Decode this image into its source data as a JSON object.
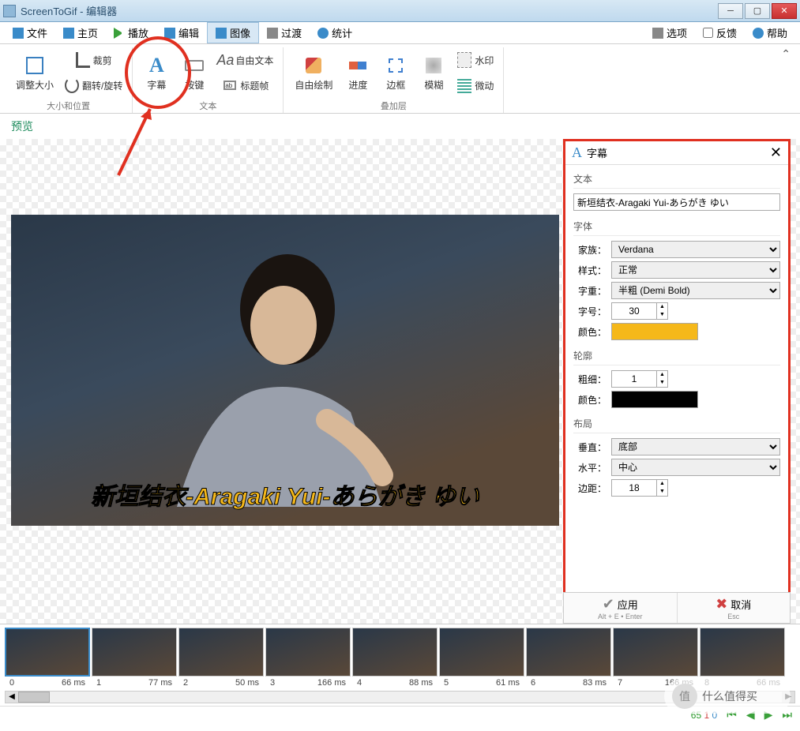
{
  "window": {
    "title": "ScreenToGif - 编辑器"
  },
  "menu": {
    "file": "文件",
    "home": "主页",
    "play": "播放",
    "edit": "编辑",
    "image": "图像",
    "transition": "过渡",
    "stats": "统计",
    "options": "选项",
    "feedback": "反馈",
    "help": "帮助"
  },
  "ribbon": {
    "groups": {
      "size": {
        "label": "大小和位置",
        "resize": "调整大小",
        "crop": "裁剪",
        "rotate": "翻转/旋转"
      },
      "text": {
        "label": "文本",
        "caption": "字幕",
        "keys": "按键",
        "free": "自由文本",
        "title": "标题帧"
      },
      "overlay": {
        "label": "叠加层",
        "draw": "自由绘制",
        "progress": "进度",
        "border": "边框",
        "blur": "模糊",
        "water": "水印",
        "micro": "微动"
      }
    }
  },
  "preview_label": "预览",
  "caption_preview": "新垣结衣-Aragaki Yui-あらがき ゆい",
  "panel": {
    "title": "字幕",
    "text_section": "文本",
    "text_value": "新垣结衣-Aragaki Yui-あらがき ゆい",
    "font_section": "字体",
    "family_lbl": "家族：",
    "family_val": "Verdana",
    "style_lbl": "样式：",
    "style_val": "正常",
    "weight_lbl": "字重：",
    "weight_val": "半粗 (Demi Bold)",
    "size_lbl": "字号：",
    "size_val": "30",
    "color_lbl": "颜色：",
    "color_val": "#f5b81a",
    "outline_section": "轮廓",
    "thick_lbl": "粗细：",
    "thick_val": "1",
    "ocolor_lbl": "颜色：",
    "ocolor_val": "#000000",
    "layout_section": "布局",
    "vert_lbl": "垂直：",
    "vert_val": "底部",
    "horiz_lbl": "水平：",
    "horiz_val": "中心",
    "margin_lbl": "边距：",
    "margin_val": "18",
    "apply": "应用",
    "apply_sub": "Alt + E • Enter",
    "cancel": "取消",
    "cancel_sub": "Esc"
  },
  "frames": [
    {
      "idx": "0",
      "ms": "66 ms"
    },
    {
      "idx": "1",
      "ms": "77 ms"
    },
    {
      "idx": "2",
      "ms": "50 ms"
    },
    {
      "idx": "3",
      "ms": "166 ms"
    },
    {
      "idx": "4",
      "ms": "88 ms"
    },
    {
      "idx": "5",
      "ms": "61 ms"
    },
    {
      "idx": "6",
      "ms": "83 ms"
    },
    {
      "idx": "7",
      "ms": "166 ms"
    },
    {
      "idx": "8",
      "ms": "66 ms"
    }
  ],
  "status": {
    "n1": "65",
    "n2": "1",
    "n3": "0"
  },
  "badge": {
    "char": "值",
    "text": "什么值得买"
  }
}
